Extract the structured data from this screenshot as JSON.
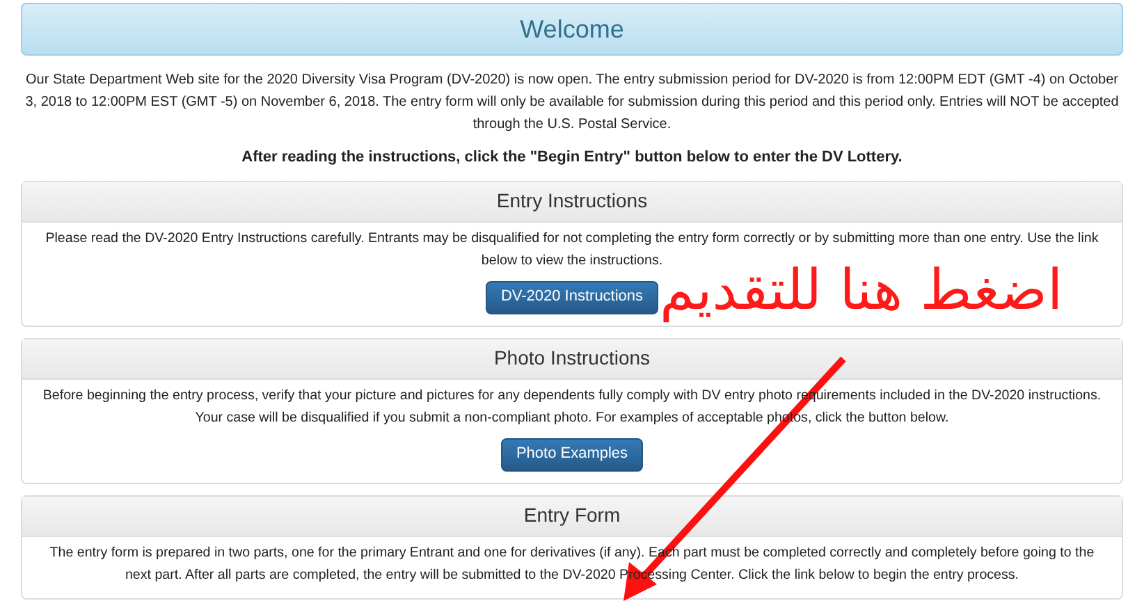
{
  "header": {
    "title": "Welcome"
  },
  "intro": "Our State Department Web site for the 2020 Diversity Visa Program (DV-2020) is now open. The entry submission period for DV-2020 is from 12:00PM EDT (GMT -4) on October 3, 2018 to 12:00PM EST (GMT -5) on November 6, 2018. The entry form will only be available for submission during this period and this period only. Entries will NOT be accepted through the U.S. Postal Service.",
  "notice": "After reading the instructions, click the \"Begin Entry\" button below to enter the DV Lottery.",
  "panels": [
    {
      "title": "Entry Instructions",
      "text": "Please read the DV-2020 Entry Instructions carefully. Entrants may be disqualified for not completing the entry form correctly or by submitting more than one entry. Use the link below to view the instructions.",
      "button": "DV-2020 Instructions"
    },
    {
      "title": "Photo Instructions",
      "text": "Before beginning the entry process, verify that your picture and pictures for any dependents fully comply with DV entry photo requirements included in the DV-2020 instructions. Your case will be disqualified if you submit a non-compliant photo.  For examples of acceptable photos, click the button below.",
      "button": "Photo Examples"
    },
    {
      "title": "Entry Form",
      "text": "The entry form is prepared in two parts, one for the primary Entrant and one for derivatives (if any). Each part must be completed correctly and completely before going to the next part. After all parts are completed, the entry will be submitted to the DV-2020 Processing Center. Click the link below to begin the entry process."
    }
  ],
  "annotation": {
    "text": "اضغط هنا للتقديم"
  }
}
